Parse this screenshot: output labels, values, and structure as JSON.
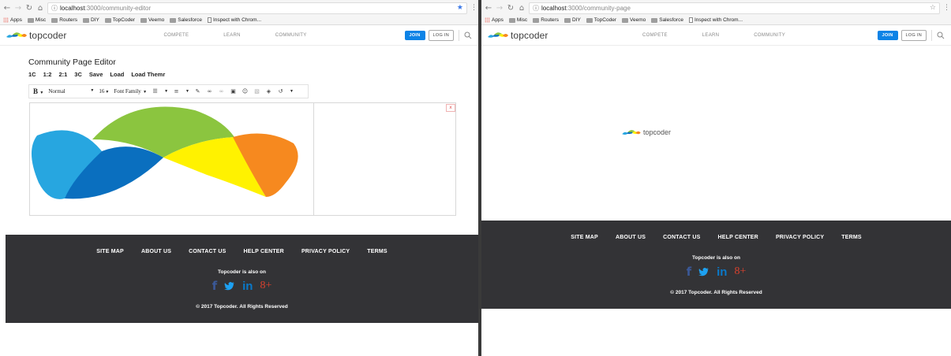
{
  "left_window": {
    "url_host": "localhost",
    "url_path": ":3000/community-editor",
    "bookmarks": [
      "Apps",
      "Misc",
      "Routers",
      "DIY",
      "TopCoder",
      "Veemo",
      "Salesforce",
      "Inspect with Chrom..."
    ],
    "editor": {
      "title": "Community Page Editor",
      "layout_buttons": [
        "1C",
        "1:2",
        "2:1",
        "3C",
        "Save",
        "Load",
        "Load Themr"
      ],
      "toolbar": {
        "bold": "B",
        "block_type": "Normal",
        "font_size": "16",
        "font_family": "Font Family"
      },
      "close_label": "x"
    }
  },
  "right_window": {
    "url_host": "localhost",
    "url_path": ":3000/community-page",
    "bookmarks": [
      "Apps",
      "Misc",
      "Routers",
      "DIY",
      "TopCoder",
      "Veemo",
      "Salesforce",
      "Inspect with Chrom..."
    ],
    "loader_logo_text": "topcoder"
  },
  "site": {
    "logo_text": "topcoder",
    "nav": [
      "COMPETE",
      "LEARN",
      "COMMUNITY"
    ],
    "join_label": "JOIN",
    "login_label": "LOG IN"
  },
  "footer": {
    "links": [
      "SITE MAP",
      "ABOUT US",
      "CONTACT US",
      "HELP CENTER",
      "PRIVACY POLICY",
      "TERMS"
    ],
    "also_on": "Topcoder is also on",
    "social": {
      "facebook": "f",
      "linkedin": "in",
      "googleplus": "8+"
    },
    "copyright": "© 2017 Topcoder. All Rights Reserved"
  },
  "colors": {
    "footer_bg": "#333336",
    "join_blue": "#0d83e6",
    "logo_blue": "#0a6fbf",
    "logo_lightblue": "#27a6e0",
    "logo_green": "#8bc53f",
    "logo_yellow": "#fff200",
    "logo_orange": "#f6891f",
    "bookmark_star": "#3b78e7"
  },
  "icons": {
    "back": "arrow-left-icon",
    "forward": "arrow-right-icon",
    "reload": "reload-icon",
    "home": "home-icon",
    "info": "info-icon",
    "star": "star-icon",
    "menu": "more-vert-icon",
    "search": "search-icon"
  }
}
